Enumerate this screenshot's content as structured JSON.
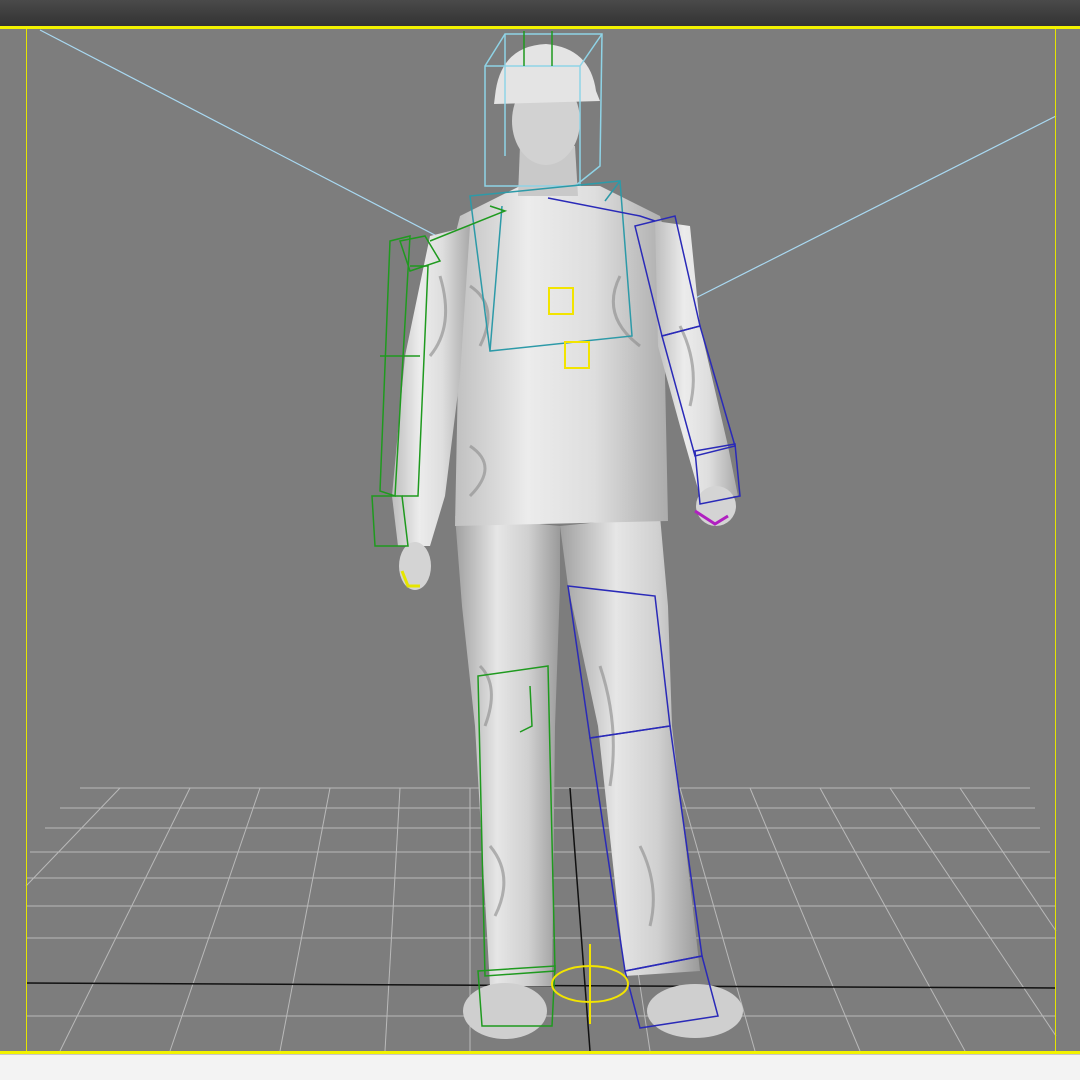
{
  "viewport": {
    "background": "#7d7d7d",
    "active_border_color": "#f2f200",
    "grid_color": "#b9b9b9",
    "light_line_color": "#a9d9f2"
  },
  "rig": {
    "left_side_color": "#1f9a1f",
    "right_side_color": "#2a2ab8",
    "spine_color": "#2d9aa8",
    "head_color": "#8fd3e6",
    "root_color": "#f2e400",
    "hand_accent_color": "#b020c0"
  },
  "model": {
    "icon": "human-figure-icon",
    "skin_color": "#d9d9d9"
  }
}
